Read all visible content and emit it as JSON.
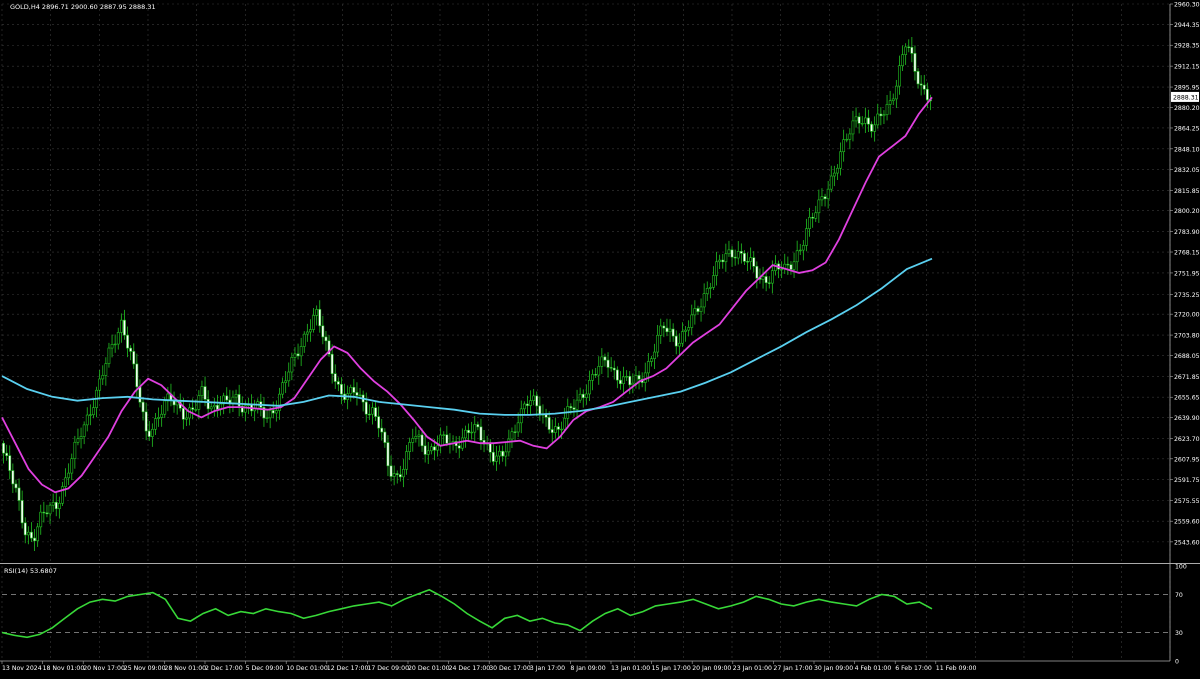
{
  "header": {
    "symbol_line": "GOLD,H4  2896.71 2900.60 2887.95 2888.31"
  },
  "price_label": "2888.31",
  "rsi_header": "RSI(14) 53.6807",
  "chart_data": [
    {
      "type": "candlestick",
      "title": "GOLD,H4",
      "ohlc_last": {
        "open": 2896.71,
        "high": 2900.6,
        "low": 2887.95,
        "close": 2888.31
      },
      "y_ticks": [
        "2960.30",
        "2944.35",
        "2928.35",
        "2912.15",
        "2895.95",
        "2880.20",
        "2864.25",
        "2848.10",
        "2832.05",
        "2815.85",
        "2800.20",
        "2783.90",
        "2768.15",
        "2751.95",
        "2735.25",
        "2720.00",
        "2703.80",
        "2688.05",
        "2671.85",
        "2655.65",
        "2639.90",
        "2623.70",
        "2607.95",
        "2591.75",
        "2575.55",
        "2559.60",
        "2543.60"
      ],
      "ylim": [
        2528.0,
        2960.3
      ],
      "x_ticks": [
        "13 Nov 2024",
        "18 Nov 01:00",
        "20 Nov 17:00",
        "25 Nov 09:00",
        "28 Nov 01:00",
        "2 Dec 17:00",
        "5 Dec 09:00",
        "10 Dec 01:00",
        "12 Dec 17:00",
        "17 Dec 09:00",
        "20 Dec 01:00",
        "24 Dec 17:00",
        "30 Dec 17:00",
        "3 Jan 17:00",
        "8 Jan 09:00",
        "13 Jan 01:00",
        "15 Jan 17:00",
        "20 Jan 09:00",
        "23 Jan 01:00",
        "27 Jan 17:00",
        "30 Jan 09:00",
        "4 Feb 01:00",
        "6 Feb 17:00",
        "11 Feb 09:00"
      ],
      "close_path": [
        2620,
        2600,
        2580,
        2555,
        2545,
        2560,
        2570,
        2575,
        2590,
        2610,
        2630,
        2645,
        2660,
        2680,
        2700,
        2715,
        2690,
        2660,
        2630,
        2635,
        2645,
        2655,
        2650,
        2642,
        2645,
        2660,
        2648,
        2652,
        2650,
        2655,
        2650,
        2648,
        2645,
        2640,
        2650,
        2665,
        2680,
        2695,
        2710,
        2720,
        2700,
        2680,
        2660,
        2655,
        2660,
        2650,
        2645,
        2630,
        2600,
        2595,
        2605,
        2625,
        2620,
        2615,
        2620,
        2622,
        2618,
        2625,
        2630,
        2628,
        2620,
        2612,
        2608,
        2620,
        2640,
        2655,
        2650,
        2640,
        2635,
        2630,
        2640,
        2650,
        2660,
        2668,
        2678,
        2685,
        2675,
        2668,
        2665,
        2670,
        2680,
        2695,
        2710,
        2705,
        2700,
        2710,
        2720,
        2735,
        2750,
        2760,
        2765,
        2770,
        2765,
        2755,
        2745,
        2750,
        2758,
        2752,
        2760,
        2775,
        2790,
        2800,
        2815,
        2830,
        2845,
        2860,
        2875,
        2870,
        2862,
        2875,
        2885,
        2905,
        2930,
        2910,
        2896,
        2888
      ],
      "series": [
        {
          "name": "",
          "kind": "moving-average",
          "color": "#e040e0",
          "values": [
            2640,
            2620,
            2600,
            2588,
            2582,
            2585,
            2595,
            2610,
            2625,
            2645,
            2660,
            2670,
            2665,
            2655,
            2645,
            2640,
            2645,
            2648,
            2648,
            2647,
            2646,
            2648,
            2655,
            2670,
            2685,
            2695,
            2690,
            2678,
            2668,
            2660,
            2650,
            2638,
            2625,
            2618,
            2620,
            2622,
            2620,
            2620,
            2621,
            2622,
            2618,
            2616,
            2625,
            2638,
            2645,
            2648,
            2652,
            2660,
            2668,
            2672,
            2678,
            2688,
            2698,
            2705,
            2712,
            2725,
            2738,
            2748,
            2758,
            2755,
            2752,
            2754,
            2760,
            2778,
            2800,
            2822,
            2842,
            2850,
            2858,
            2875,
            2888
          ]
        },
        {
          "name": "",
          "kind": "moving-average",
          "color": "#5ad0f0",
          "values": [
            2672,
            2662,
            2656,
            2653,
            2655,
            2656,
            2654,
            2653,
            2652,
            2651,
            2650,
            2649,
            2652,
            2657,
            2656,
            2652,
            2650,
            2648,
            2646,
            2643,
            2642,
            2642,
            2643,
            2645,
            2648,
            2652,
            2656,
            2660,
            2667,
            2675,
            2685,
            2695,
            2706,
            2716,
            2727,
            2740,
            2755,
            2763
          ]
        }
      ]
    },
    {
      "type": "line",
      "title": "RSI(14) 53.6807",
      "ylim": [
        0,
        100
      ],
      "y_ticks": [
        "100",
        "70",
        "30",
        "0"
      ],
      "levels": [
        70,
        30
      ],
      "series": [
        {
          "name": "",
          "color": "#38d838",
          "values": [
            30,
            27,
            25,
            28,
            35,
            45,
            55,
            62,
            65,
            63,
            68,
            70,
            72,
            65,
            45,
            42,
            50,
            55,
            48,
            52,
            50,
            55,
            52,
            50,
            45,
            48,
            52,
            55,
            58,
            60,
            62,
            58,
            65,
            70,
            75,
            68,
            60,
            50,
            42,
            35,
            45,
            48,
            42,
            45,
            40,
            38,
            32,
            42,
            50,
            55,
            48,
            52,
            58,
            60,
            62,
            65,
            60,
            55,
            58,
            62,
            68,
            65,
            60,
            58,
            62,
            65,
            62,
            60,
            58,
            65,
            70,
            68,
            60,
            62,
            55
          ]
        }
      ]
    }
  ]
}
